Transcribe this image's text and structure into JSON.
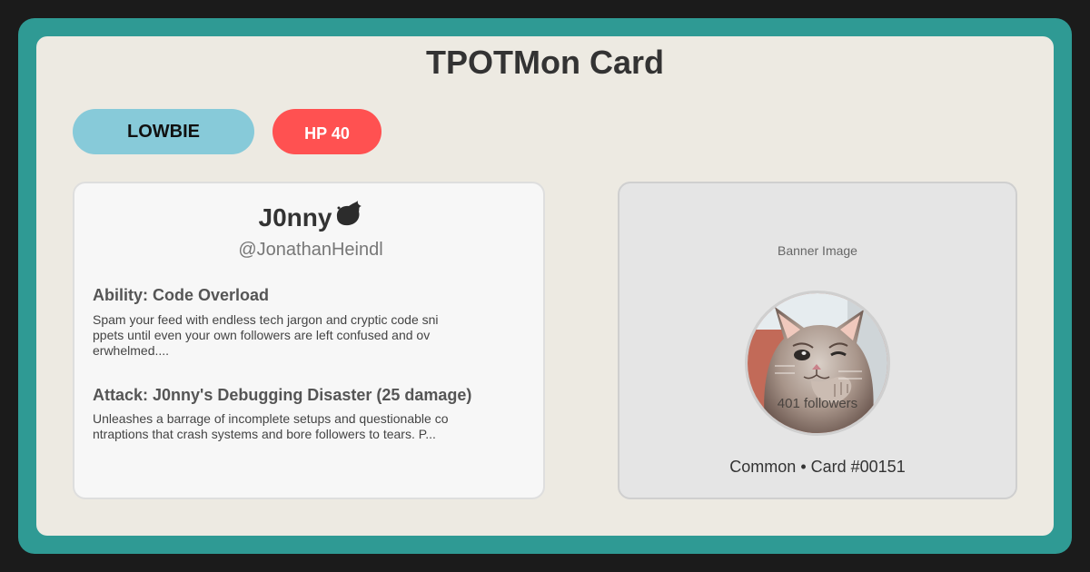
{
  "title": "TPOTMon Card",
  "badges": {
    "rank": "LOWBIE",
    "hp": "HP 40"
  },
  "profile": {
    "name": "J0nny",
    "name_icon": "ink-blob-icon",
    "handle": "@JonathanHeindl"
  },
  "ability": {
    "title": "Ability: Code Overload",
    "desc_lines": [
      "Spam your feed with endless tech jargon and cryptic code sni",
      "ppets until even your own followers are left confused and ov",
      "erwhelmed...."
    ]
  },
  "attack": {
    "title": "Attack: J0nny's Debugging Disaster (25 damage)",
    "desc_lines": [
      "Unleashes a barrage of incomplete setups and questionable co",
      "ntraptions that crash systems and bore followers to tears. P..."
    ]
  },
  "side": {
    "banner_label": "Banner Image",
    "followers": "401 followers",
    "footer": "Common • Card #00151"
  },
  "colors": {
    "frame": "#2f9a94",
    "card": "#edeae2",
    "rank_badge": "#87cad9",
    "hp_badge": "#ff5151"
  }
}
